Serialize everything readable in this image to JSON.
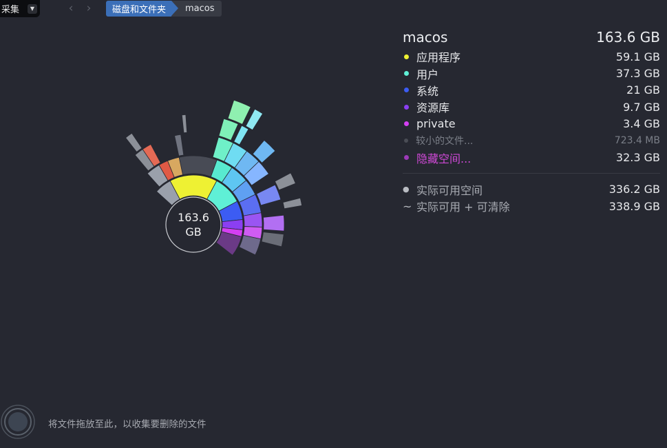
{
  "toolbar": {
    "collect_label": "采集",
    "collect_caret_icon": "caret-down-icon"
  },
  "navigation": {
    "back_icon": "chevron-left-icon",
    "forward_icon": "chevron-right-icon",
    "breadcrumb": [
      "磁盘和文件夹",
      "macos"
    ]
  },
  "chart_center": {
    "value": "163.6",
    "unit": "GB"
  },
  "summary": {
    "name": "macos",
    "total": "163.6 GB",
    "items": [
      {
        "label": "应用程序",
        "size": "59.1 GB",
        "color": "#eef133"
      },
      {
        "label": "用户",
        "size": "37.3 GB",
        "color": "#5ff0d6"
      },
      {
        "label": "系统",
        "size": "21    GB",
        "color": "#3c5cf3"
      },
      {
        "label": "资源库",
        "size": "9.7 GB",
        "color": "#8b3ff2"
      },
      {
        "label": "private",
        "size": "3.4 GB",
        "color": "#d43ff2"
      },
      {
        "label": "较小的文件...",
        "size": "723.4  MB",
        "color": "#4a4d55"
      },
      {
        "label": "隐藏空间...",
        "size": "32.3 GB",
        "color": "#9c3ab8"
      }
    ],
    "free_space": {
      "symbol": "●",
      "label": "实际可用空间",
      "size": "336.2 GB"
    },
    "purgeable": {
      "symbol": "~",
      "label": "实际可用 + 可清除",
      "size": "338.9 GB"
    }
  },
  "drop_area": {
    "text": "将文件拖放至此，以收集要删除的文件",
    "icon": "collector-ring-icon"
  }
}
